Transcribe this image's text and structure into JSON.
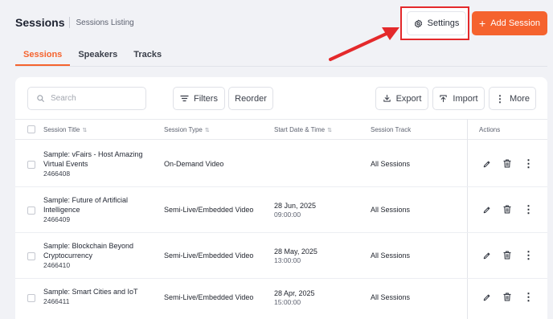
{
  "header": {
    "title": "Sessions",
    "subtitle": "Sessions Listing",
    "settings_label": "Settings",
    "add_label": "Add Session"
  },
  "tabs": [
    {
      "label": "Sessions",
      "active": true
    },
    {
      "label": "Speakers",
      "active": false
    },
    {
      "label": "Tracks",
      "active": false
    }
  ],
  "toolbar": {
    "search_placeholder": "Search",
    "filters_label": "Filters",
    "reorder_label": "Reorder",
    "export_label": "Export",
    "import_label": "Import",
    "more_label": "More"
  },
  "table": {
    "columns": [
      "Session Title",
      "Session Type",
      "Start Date & Time",
      "Session Track",
      "Actions"
    ],
    "rows": [
      {
        "title": "Sample: vFairs - Host Amazing Virtual Events",
        "id": "2466408",
        "type": "On-Demand Video",
        "date": "",
        "time": "",
        "track": "All Sessions"
      },
      {
        "title": "Sample: Future of Artificial Intelligence",
        "id": "2466409",
        "type": "Semi-Live/Embedded Video",
        "date": "28 Jun, 2025",
        "time": "09:00:00",
        "track": "All Sessions"
      },
      {
        "title": "Sample: Blockchain Beyond Cryptocurrency",
        "id": "2466410",
        "type": "Semi-Live/Embedded Video",
        "date": "28 May, 2025",
        "time": "13:00:00",
        "track": "All Sessions"
      },
      {
        "title": "Sample: Smart Cities and IoT",
        "id": "2466411",
        "type": "Semi-Live/Embedded Video",
        "date": "28 Apr, 2025",
        "time": "15:00:00",
        "track": "All Sessions"
      }
    ]
  },
  "colors": {
    "accent": "#f5632e",
    "highlight": "#e4292b",
    "background": "#f1f2f6"
  },
  "icons": [
    "settings-icon",
    "plus-icon",
    "search-icon",
    "filter-icon",
    "export-icon",
    "import-icon",
    "more-icon",
    "edit-icon",
    "delete-icon",
    "kebab-icon"
  ]
}
